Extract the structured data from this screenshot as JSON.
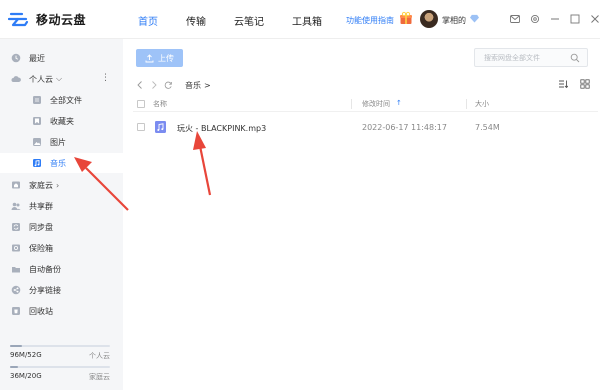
{
  "app": {
    "name": "移动云盘"
  },
  "nav": {
    "tabs": [
      "首页",
      "传输",
      "云笔记",
      "工具箱"
    ],
    "active_index": 0
  },
  "header": {
    "guide_link": "功能使用指南",
    "username": "掌相的"
  },
  "sidebar": {
    "items": [
      {
        "label": "最近",
        "icon": "clock-icon"
      },
      {
        "label": "个人云",
        "icon": "cloud-icon"
      },
      {
        "label": "全部文件",
        "icon": "all-files-icon"
      },
      {
        "label": "收藏夹",
        "icon": "favorites-icon"
      },
      {
        "label": "图片",
        "icon": "image-icon"
      },
      {
        "label": "音乐",
        "icon": "music-icon"
      },
      {
        "label": "家庭云",
        "icon": "home-icon"
      },
      {
        "label": "共享群",
        "icon": "share-group-icon"
      },
      {
        "label": "同步盘",
        "icon": "sync-icon"
      },
      {
        "label": "保险箱",
        "icon": "safe-icon"
      },
      {
        "label": "自动备份",
        "icon": "backup-icon"
      },
      {
        "label": "分享链接",
        "icon": "share-link-icon"
      },
      {
        "label": "回收站",
        "icon": "recycle-bin-icon"
      }
    ],
    "active_index": 5,
    "storage": [
      {
        "used": "96M/52G",
        "name": "个人云",
        "fraction": 0.002
      },
      {
        "used": "36M/20G",
        "name": "家庭云",
        "fraction": 0.002
      }
    ]
  },
  "toolbar": {
    "upload_label": "上传"
  },
  "search": {
    "placeholder": "搜索网盘全部文件"
  },
  "breadcrumb": {
    "current": "音乐",
    "separator": ">"
  },
  "table": {
    "headers": {
      "name": "名称",
      "modified": "修改时间",
      "sort_indicator": "↑",
      "size": "大小"
    },
    "rows": [
      {
        "name": "玩火 - BLACKPINK.mp3",
        "modified": "2022-06-17 11:48:17",
        "size": "7.54M"
      }
    ]
  },
  "colors": {
    "accent": "#2e7cf6",
    "annotation_arrow": "#e8463a"
  }
}
